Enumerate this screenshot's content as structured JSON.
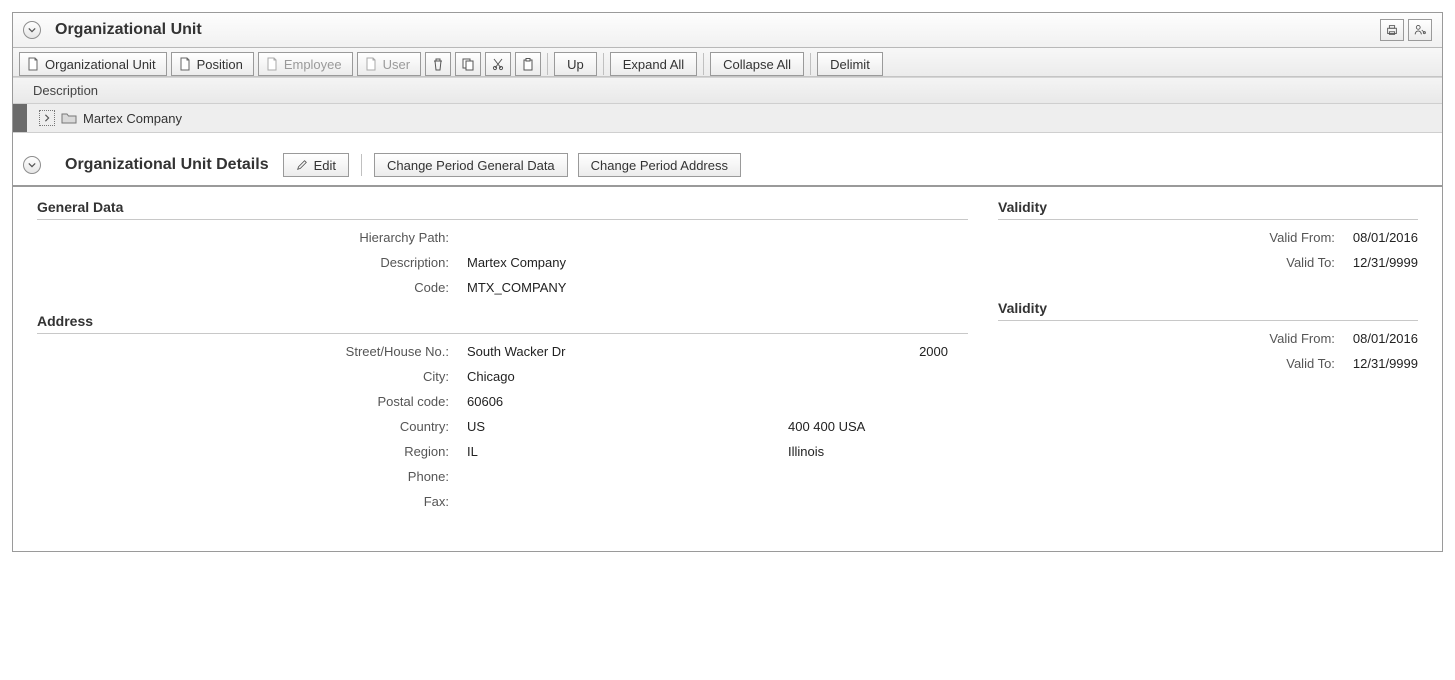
{
  "header": {
    "title": "Organizational Unit"
  },
  "toolbar": {
    "org_unit": "Organizational Unit",
    "position": "Position",
    "employee": "Employee",
    "user": "User",
    "up": "Up",
    "expand_all": "Expand All",
    "collapse_all": "Collapse All",
    "delimit": "Delimit"
  },
  "tree": {
    "column_header": "Description",
    "node_label": "Martex Company"
  },
  "details": {
    "title": "Organizational Unit Details",
    "edit": "Edit",
    "change_period_general": "Change Period General Data",
    "change_period_address": "Change Period Address"
  },
  "sections": {
    "general_title": "General Data",
    "address_title": "Address",
    "validity_title": "Validity"
  },
  "general": {
    "hierarchy_path_label": "Hierarchy Path:",
    "hierarchy_path_value": "",
    "description_label": "Description:",
    "description_value": "Martex Company",
    "code_label": "Code:",
    "code_value": "MTX_COMPANY"
  },
  "address": {
    "street_label": "Street/House No.:",
    "street_value": "South Wacker Dr",
    "house_no": "2000",
    "city_label": "City:",
    "city_value": "Chicago",
    "postal_label": "Postal code:",
    "postal_value": "60606",
    "country_label": "Country:",
    "country_value": "US",
    "country_extra": "400 400 USA",
    "region_label": "Region:",
    "region_value": "IL",
    "region_extra": "Illinois",
    "phone_label": "Phone:",
    "phone_value": "",
    "fax_label": "Fax:",
    "fax_value": ""
  },
  "validity_general": {
    "from_label": "Valid From:",
    "from_value": "08/01/2016",
    "to_label": "Valid To:",
    "to_value": "12/31/9999"
  },
  "validity_address": {
    "from_label": "Valid From:",
    "from_value": "08/01/2016",
    "to_label": "Valid To:",
    "to_value": "12/31/9999"
  }
}
